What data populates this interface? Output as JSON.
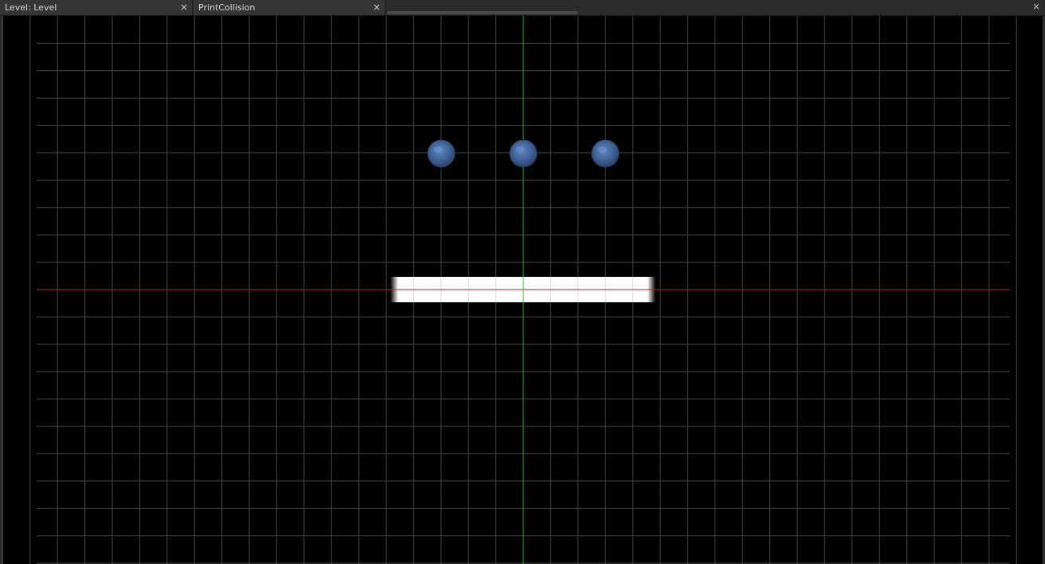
{
  "tabs": [
    {
      "label": "Level: Level",
      "close_glyph": "×"
    },
    {
      "label": "PrintCollision",
      "close_glyph": "×"
    }
  ],
  "panel_close_glyph": "×",
  "viewport": {
    "colors": {
      "background": "#000000",
      "grid": "#4a4a4a",
      "x_axis": "#b3202a",
      "y_axis": "#1fbf2a",
      "platform": "#ffffff",
      "sphere": "#4a6a9a"
    },
    "objects": {
      "spheres": 3,
      "platforms": 1
    }
  }
}
